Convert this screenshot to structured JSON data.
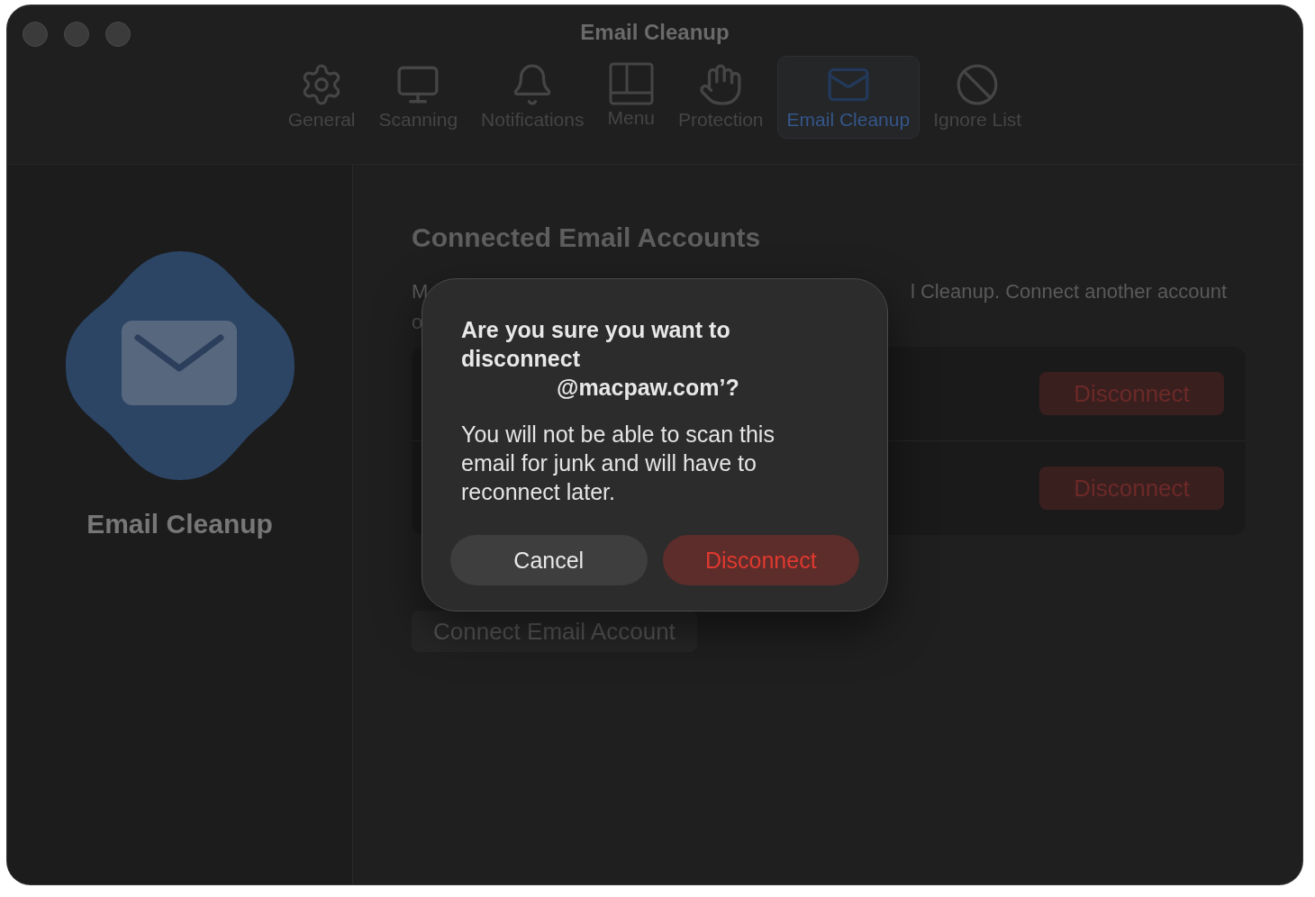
{
  "window": {
    "title": "Email Cleanup"
  },
  "tabs": [
    {
      "label": "General",
      "kind": "gear",
      "selected": false
    },
    {
      "label": "Scanning",
      "kind": "monitor",
      "selected": false
    },
    {
      "label": "Notifications",
      "kind": "bell",
      "selected": false
    },
    {
      "label": "Menu",
      "kind": "panel",
      "selected": false
    },
    {
      "label": "Protection",
      "kind": "hand",
      "selected": false
    },
    {
      "label": "Email Cleanup",
      "kind": "mail",
      "selected": true
    },
    {
      "label": "Ignore List",
      "kind": "ban",
      "selected": false
    }
  ],
  "sidebar": {
    "title": "Email Cleanup"
  },
  "content": {
    "heading": "Connected Email Accounts",
    "description_line_1_start": "M",
    "description_line_1_end": "l Cleanup. Connect another account",
    "description_line_2_start": "o",
    "accounts": [
      {
        "button": "Disconnect"
      },
      {
        "button": "Disconnect"
      }
    ],
    "connect_button": "Connect Email Account"
  },
  "dialog": {
    "title_lines": [
      "Are you sure you want to disconnect",
      "@macpaw.com’?"
    ],
    "message": "You will not be able to scan this email for junk and will have to reconnect later.",
    "buttons": [
      {
        "label": "Cancel",
        "kind": "cancel"
      },
      {
        "label": "Disconnect",
        "kind": "destructive"
      }
    ]
  }
}
